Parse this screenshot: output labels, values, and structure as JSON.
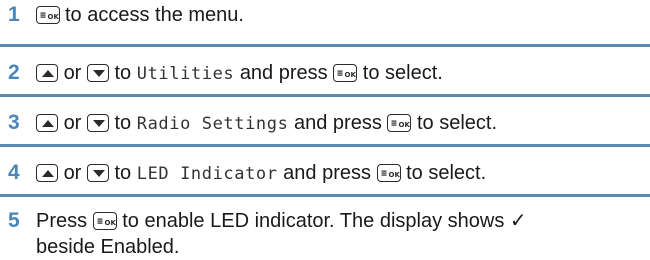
{
  "steps": [
    {
      "num": "1",
      "parts": {
        "after_key": "to access the menu."
      }
    },
    {
      "num": "2",
      "parts": {
        "or": "or",
        "to": "to",
        "target": "Utilities",
        "press": "and press",
        "end": "to select."
      }
    },
    {
      "num": "3",
      "parts": {
        "or": "or",
        "to": "to",
        "target": "Radio Settings",
        "press": "and press",
        "end": "to select."
      }
    },
    {
      "num": "4",
      "parts": {
        "or": "or",
        "to": "to",
        "target": "LED Indicator",
        "press": "and press",
        "end": "to select."
      }
    },
    {
      "num": "5",
      "parts": {
        "press": "Press",
        "line1": "to enable LED indicator. The display shows ✓",
        "line2": "beside Enabled."
      }
    }
  ],
  "keys": {
    "ok_label": "OK",
    "up_icon": "up-arrow-key-icon",
    "down_icon": "down-arrow-key-icon"
  },
  "colors": {
    "step_number": "#4a86b8",
    "divider": "#5b8ab0"
  }
}
